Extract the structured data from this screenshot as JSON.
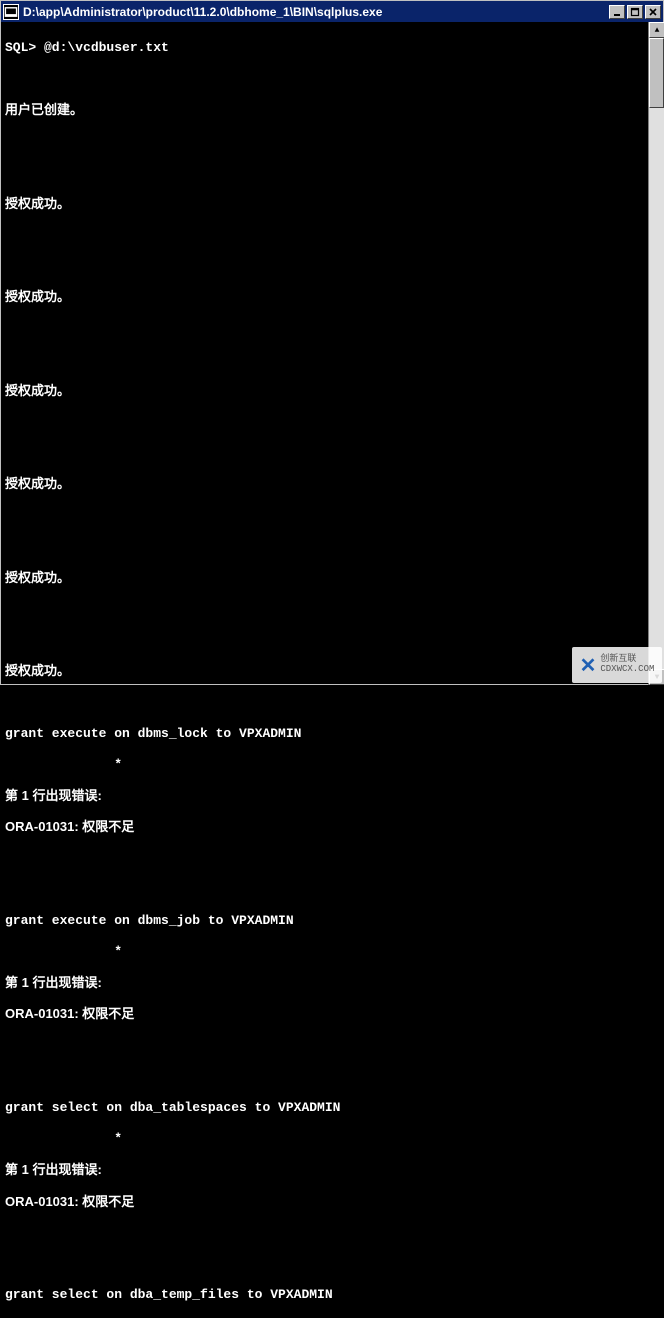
{
  "window": {
    "title": "D:\\app\\Administrator\\product\\11.2.0\\dbhome_1\\BIN\\sqlplus.exe"
  },
  "console": {
    "prompt_line": "SQL> @d:\\vcdbuser.txt",
    "msg_user_created": "用户已创建。",
    "msg_grant_success": "授权成功。",
    "cmd_grant_dbms_lock": "grant execute on dbms_lock to VPXADMIN",
    "cmd_grant_dbms_job": "grant execute on dbms_job to VPXADMIN",
    "cmd_grant_dba_tablespaces": "grant select on dba_tablespaces to VPXADMIN",
    "cmd_grant_dba_temp_files": "grant select on dba_temp_files to VPXADMIN",
    "asterisk_indent": "              *",
    "err_line1": "第 1 行出现错误:",
    "err_ora": "ORA-01031: 权限不足"
  },
  "watermark": {
    "brand": "创新互联",
    "url": "CDXWCX.COM"
  }
}
